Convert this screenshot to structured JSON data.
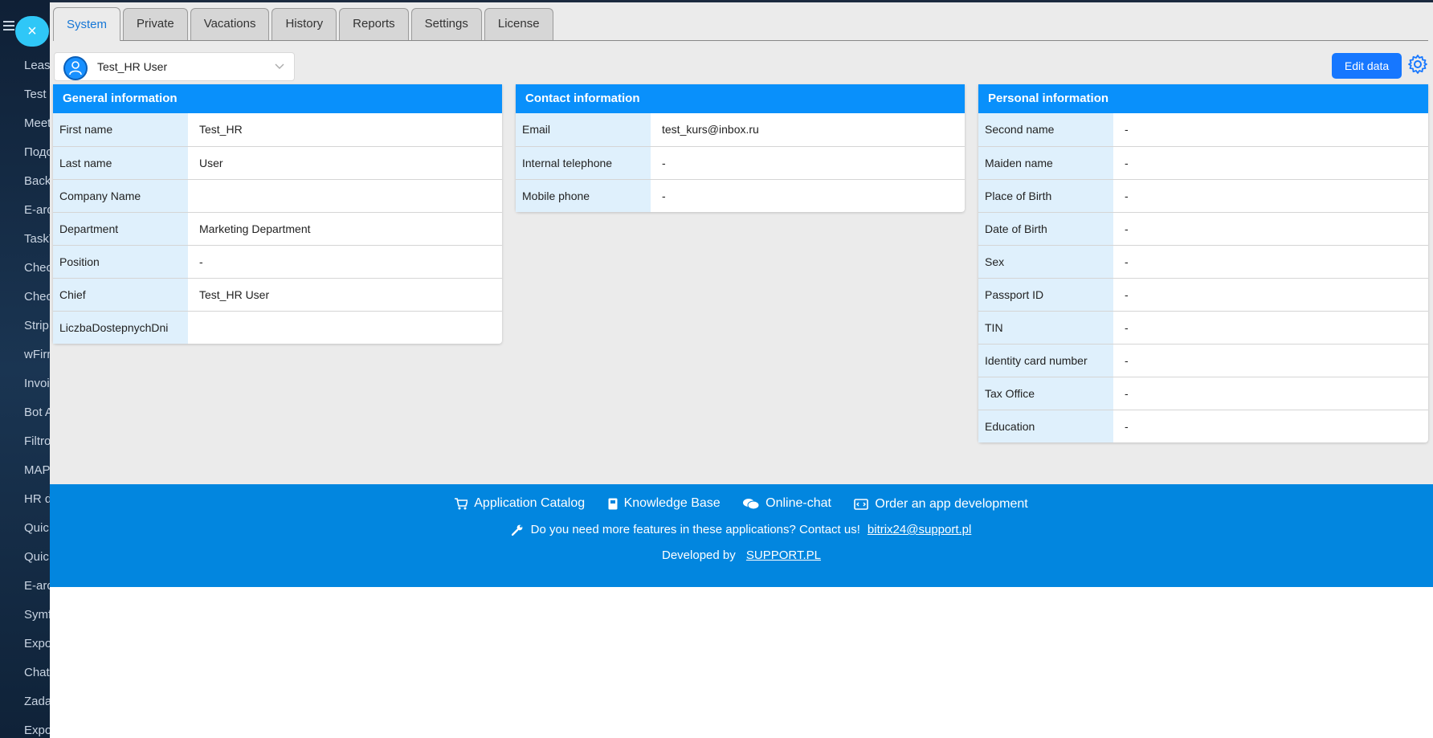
{
  "sidebar": {
    "items": [
      "Leasi",
      "Test",
      "Meet",
      "Подс",
      "Back",
      "E-arc",
      "TaskT",
      "Chec",
      "Chec",
      "Strip",
      "wFirm",
      "Invoi",
      "Bot A",
      "Filtro",
      "MAP",
      "HR d",
      "Quic",
      "Quic",
      "E-arc",
      "Symf",
      "Expo",
      "Chat",
      "Zada",
      "Expo"
    ],
    "close_glyph": "×"
  },
  "tabs": [
    {
      "label": "System",
      "active": true
    },
    {
      "label": "Private",
      "active": false
    },
    {
      "label": "Vacations",
      "active": false
    },
    {
      "label": "History",
      "active": false
    },
    {
      "label": "Reports",
      "active": false
    },
    {
      "label": "Settings",
      "active": false
    },
    {
      "label": "License",
      "active": false
    }
  ],
  "user_select": {
    "name": "Test_HR User"
  },
  "edit_button": {
    "label": "Edit data"
  },
  "cards": {
    "general": {
      "title": "General information",
      "rows": [
        {
          "label": "First name",
          "value": "Test_HR"
        },
        {
          "label": "Last name",
          "value": "User"
        },
        {
          "label": "Company Name",
          "value": ""
        },
        {
          "label": "Department",
          "value": "Marketing Department"
        },
        {
          "label": "Position",
          "value": "-"
        },
        {
          "label": "Chief",
          "value": "Test_HR User"
        },
        {
          "label": "LiczbaDostepnychDni",
          "value": ""
        }
      ]
    },
    "contact": {
      "title": "Contact information",
      "rows": [
        {
          "label": "Email",
          "value": "test_kurs@inbox.ru"
        },
        {
          "label": "Internal telephone",
          "value": "-"
        },
        {
          "label": "Mobile phone",
          "value": "-"
        }
      ]
    },
    "personal": {
      "title": "Personal information",
      "rows": [
        {
          "label": "Second name",
          "value": "-"
        },
        {
          "label": "Maiden name",
          "value": "-"
        },
        {
          "label": "Place of Birth",
          "value": "-"
        },
        {
          "label": "Date of Birth",
          "value": "-"
        },
        {
          "label": "Sex",
          "value": "-"
        },
        {
          "label": "Passport ID",
          "value": "-"
        },
        {
          "label": "TIN",
          "value": "-"
        },
        {
          "label": "Identity card number",
          "value": "-"
        },
        {
          "label": "Tax Office",
          "value": "-"
        },
        {
          "label": "Education",
          "value": "-"
        }
      ]
    }
  },
  "footer": {
    "links": [
      {
        "label": "Application Catalog",
        "icon": "cart-icon"
      },
      {
        "label": "Knowledge Base",
        "icon": "book-icon"
      },
      {
        "label": "Online-chat",
        "icon": "chat-icon"
      },
      {
        "label": "Order an app development",
        "icon": "code-icon"
      }
    ],
    "contact_text": "Do you need more features in these applications? Contact us!",
    "contact_email": "bitrix24@support.pl",
    "developed_by": "Developed by",
    "developer": "SUPPORT.PL"
  },
  "colors": {
    "accent": "#0990fb",
    "footer": "#0286df",
    "button": "#1677ff",
    "label_bg": "#dff0fc"
  }
}
